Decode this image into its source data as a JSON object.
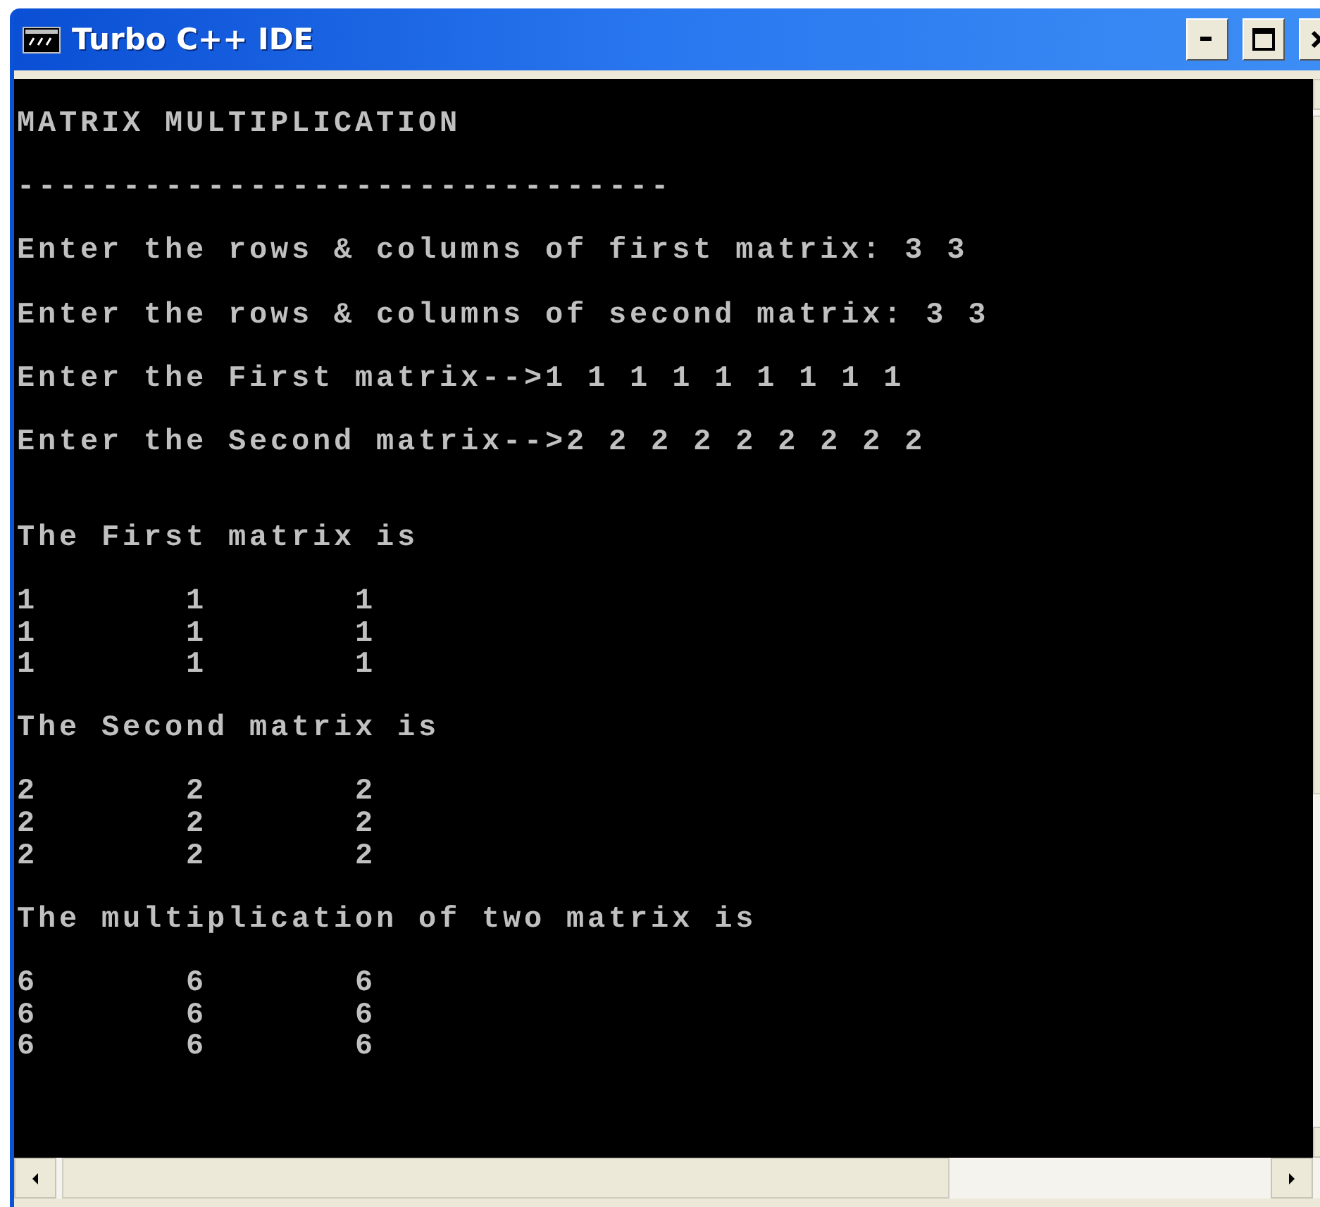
{
  "window": {
    "title": "Turbo C++ IDE"
  },
  "console": [
    {
      "kind": "heading",
      "text": "MATRIX MULTIPLICATION"
    },
    {
      "kind": "rule",
      "text": "-------------------------------"
    },
    {
      "kind": "prompt",
      "text": "Enter the rows & columns of first matrix: 3 3"
    },
    {
      "kind": "prompt",
      "text": "Enter the rows & columns of second matrix: 3 3"
    },
    {
      "kind": "prompt",
      "text": "Enter the First matrix-->1 1 1 1 1 1 1 1 1"
    },
    {
      "kind": "prompt",
      "text": "Enter the Second matrix-->2 2 2 2 2 2 2 2 2"
    },
    {
      "kind": "label",
      "text": "The First matrix is"
    },
    {
      "kind": "matrix",
      "rows": [
        [
          "1",
          "1",
          "1"
        ],
        [
          "1",
          "1",
          "1"
        ],
        [
          "1",
          "1",
          "1"
        ]
      ]
    },
    {
      "kind": "label",
      "text": "The Second matrix is"
    },
    {
      "kind": "matrix",
      "rows": [
        [
          "2",
          "2",
          "2"
        ],
        [
          "2",
          "2",
          "2"
        ],
        [
          "2",
          "2",
          "2"
        ]
      ]
    },
    {
      "kind": "label",
      "text": "The multiplication of two matrix is"
    },
    {
      "kind": "matrix",
      "rows": [
        [
          "6",
          "6",
          "6"
        ],
        [
          "6",
          "6",
          "6"
        ],
        [
          "6",
          "6",
          "6"
        ]
      ]
    }
  ]
}
